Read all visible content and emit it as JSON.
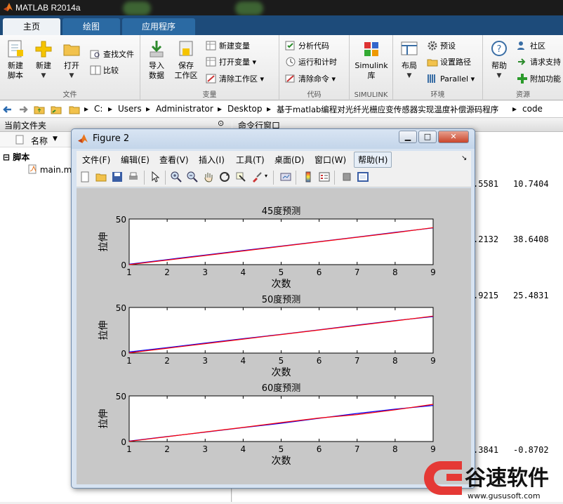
{
  "app": {
    "title": "MATLAB R2014a"
  },
  "tabs": [
    {
      "label": "主页",
      "active": true
    },
    {
      "label": "绘图",
      "active": false
    },
    {
      "label": "应用程序",
      "active": false
    }
  ],
  "ribbon": {
    "file_group": {
      "label": "文件",
      "new_script": "新建\n脚本",
      "new": "新建",
      "open": "打开",
      "find_files": "查找文件",
      "compare": "比较"
    },
    "variable_group": {
      "label": "变量",
      "import": "导入\n数据",
      "save_ws": "保存\n工作区",
      "new_var": "新建变量",
      "open_var": "打开变量",
      "clear_ws": "清除工作区"
    },
    "code_group": {
      "label": "代码",
      "analyze": "分析代码",
      "run_time": "运行和计时",
      "clear_cmd": "清除命令"
    },
    "simulink_group": {
      "label": "SIMULINK",
      "simulink": "Simulink\n库"
    },
    "env_group": {
      "label": "环境",
      "layout": "布局",
      "prefs": "预设",
      "setpath": "设置路径",
      "parallel": "Parallel"
    },
    "resources_group": {
      "label": "资源",
      "help": "帮助",
      "community": "社区",
      "support": "请求支持",
      "addons": "附加功能"
    }
  },
  "address": {
    "segments": [
      "C:",
      "Users",
      "Administrator",
      "Desktop",
      "基于matlab编程对光纤光栅应变传感器实现温度补偿源码程序",
      "code"
    ]
  },
  "left_panel": {
    "title": "当前文件夹",
    "col_name": "名称",
    "group": "脚本",
    "file": "main.m"
  },
  "command_window": {
    "title": "命令行窗口",
    "rows": [
      {
        "a": ".5581",
        "b": "10.7404"
      },
      {
        "a": ".2132",
        "b": "38.6408"
      },
      {
        "a": ".9215",
        "b": "25.4831"
      },
      {
        "a": ".3841",
        "b": "-0.8702"
      }
    ]
  },
  "figure": {
    "title": "Figure 2",
    "menu": [
      "文件(F)",
      "编辑(E)",
      "查看(V)",
      "插入(I)",
      "工具(T)",
      "桌面(D)",
      "窗口(W)",
      "帮助(H)"
    ]
  },
  "chart_data": [
    {
      "type": "line",
      "title": "45度预测",
      "xlabel": "次数",
      "ylabel": "拉伸",
      "xlim": [
        1,
        9
      ],
      "ylim": [
        0,
        50
      ],
      "xticks": [
        1,
        2,
        3,
        4,
        5,
        6,
        7,
        8,
        9
      ],
      "yticks": [
        0,
        50
      ],
      "x": [
        1,
        2,
        3,
        4,
        5,
        6,
        7,
        8,
        9
      ],
      "series": [
        {
          "color": "#0000ff",
          "values": [
            0.5,
            5.5,
            10.5,
            15.5,
            20.3,
            25.2,
            30.2,
            35.4,
            40.2
          ]
        },
        {
          "color": "#ff0000",
          "values": [
            0,
            5,
            10,
            15,
            20,
            25,
            30,
            35,
            40.5
          ]
        }
      ]
    },
    {
      "type": "line",
      "title": "50度预测",
      "xlabel": "次数",
      "ylabel": "拉伸",
      "xlim": [
        1,
        9
      ],
      "ylim": [
        0,
        50
      ],
      "xticks": [
        1,
        2,
        3,
        4,
        5,
        6,
        7,
        8,
        9
      ],
      "yticks": [
        0,
        50
      ],
      "x": [
        1,
        2,
        3,
        4,
        5,
        6,
        7,
        8,
        9
      ],
      "series": [
        {
          "color": "#0000ff",
          "values": [
            1.2,
            6,
            11,
            15.8,
            20.5,
            25.5,
            30.7,
            35.6,
            40
          ]
        },
        {
          "color": "#ff0000",
          "values": [
            0.3,
            5.3,
            10.3,
            15.3,
            20.3,
            25.3,
            30.3,
            35.3,
            40.5
          ]
        }
      ]
    },
    {
      "type": "line",
      "title": "60度预测",
      "xlabel": "次数",
      "ylabel": "拉伸",
      "xlim": [
        1,
        9
      ],
      "ylim": [
        0,
        50
      ],
      "xticks": [
        1,
        2,
        3,
        4,
        5,
        6,
        7,
        8,
        9
      ],
      "yticks": [
        0,
        50
      ],
      "x": [
        1,
        2,
        3,
        4,
        5,
        6,
        7,
        8,
        9
      ],
      "series": [
        {
          "color": "#0000ff",
          "values": [
            0.5,
            5.5,
            10.2,
            15.2,
            20,
            25.5,
            30.8,
            35.5,
            39.5
          ]
        },
        {
          "color": "#ff0000",
          "values": [
            0.2,
            5.3,
            10.5,
            15.5,
            20.8,
            25.8,
            29.5,
            34.8,
            40.8
          ]
        }
      ]
    }
  ],
  "watermark": {
    "brand": "谷速软件",
    "url": "www.gususoft.com"
  }
}
